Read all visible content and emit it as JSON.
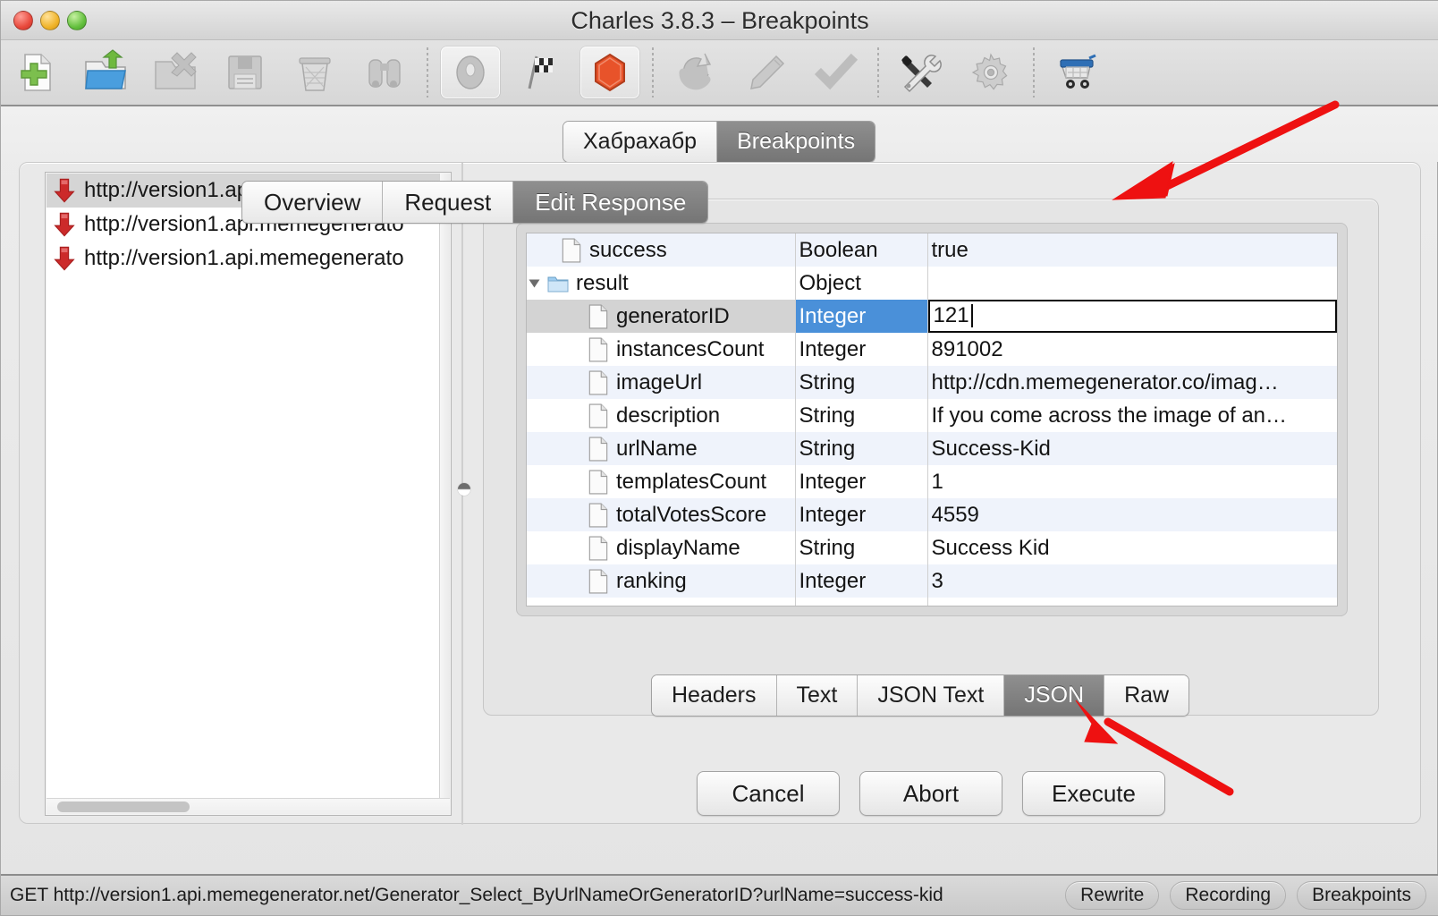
{
  "window": {
    "title": "Charles 3.8.3 – Breakpoints",
    "traffic_lights": [
      "close-button",
      "minimize-button",
      "zoom-button"
    ]
  },
  "toolbar": {
    "items": [
      {
        "name": "new-session-icon",
        "selected": false
      },
      {
        "name": "open-session-icon",
        "selected": false
      },
      {
        "name": "close-session-icon",
        "selected": false
      },
      {
        "name": "save-session-icon",
        "selected": false
      },
      {
        "name": "clear-session-icon",
        "selected": false
      },
      {
        "name": "find-icon",
        "selected": false
      },
      {
        "name": "record-icon",
        "selected": true
      },
      {
        "name": "throttle-icon",
        "selected": false
      },
      {
        "name": "stop-icon",
        "selected": true
      },
      {
        "name": "repeat-icon",
        "selected": false
      },
      {
        "name": "compose-icon",
        "selected": false
      },
      {
        "name": "validate-icon",
        "selected": false
      },
      {
        "name": "tools-icon",
        "selected": false
      },
      {
        "name": "settings-gear-icon",
        "selected": false
      },
      {
        "name": "shopping-cart-icon",
        "selected": false
      }
    ]
  },
  "window_tabs": [
    {
      "label": "Хабрахабр",
      "active": false
    },
    {
      "label": "Breakpoints",
      "active": true
    }
  ],
  "breakpoint_list": {
    "items": [
      {
        "label": "http://version1.api.memegenerato",
        "selected": true
      },
      {
        "label": "http://version1.api.memegenerato",
        "selected": false
      },
      {
        "label": "http://version1.api.memegenerato",
        "selected": false
      }
    ]
  },
  "detail_tabs": [
    {
      "label": "Overview",
      "active": false
    },
    {
      "label": "Request",
      "active": false
    },
    {
      "label": "Edit Response",
      "active": true
    }
  ],
  "json_table": {
    "rows": [
      {
        "indent": 0,
        "icon": "document-icon",
        "twisty": null,
        "name": "success",
        "type": "Boolean",
        "value": "true",
        "stripe": "odd",
        "selected": false,
        "editing": false
      },
      {
        "indent": 0,
        "icon": "folder-icon",
        "twisty": "open",
        "name": "result",
        "type": "Object",
        "value": "",
        "stripe": "even",
        "selected": false,
        "editing": false
      },
      {
        "indent": 1,
        "icon": "document-icon",
        "twisty": null,
        "name": "generatorID",
        "type": "Integer",
        "value": "121",
        "stripe": "odd",
        "selected": true,
        "editing": true
      },
      {
        "indent": 1,
        "icon": "document-icon",
        "twisty": null,
        "name": "instancesCount",
        "type": "Integer",
        "value": "891002",
        "stripe": "even",
        "selected": false,
        "editing": false
      },
      {
        "indent": 1,
        "icon": "document-icon",
        "twisty": null,
        "name": "imageUrl",
        "type": "String",
        "value": "http://cdn.memegenerator.co/imag…",
        "stripe": "odd",
        "selected": false,
        "editing": false
      },
      {
        "indent": 1,
        "icon": "document-icon",
        "twisty": null,
        "name": "description",
        "type": "String",
        "value": "If you come across the image of an…",
        "stripe": "even",
        "selected": false,
        "editing": false
      },
      {
        "indent": 1,
        "icon": "document-icon",
        "twisty": null,
        "name": "urlName",
        "type": "String",
        "value": "Success-Kid",
        "stripe": "odd",
        "selected": false,
        "editing": false
      },
      {
        "indent": 1,
        "icon": "document-icon",
        "twisty": null,
        "name": "templatesCount",
        "type": "Integer",
        "value": "1",
        "stripe": "even",
        "selected": false,
        "editing": false
      },
      {
        "indent": 1,
        "icon": "document-icon",
        "twisty": null,
        "name": "totalVotesScore",
        "type": "Integer",
        "value": "4559",
        "stripe": "odd",
        "selected": false,
        "editing": false
      },
      {
        "indent": 1,
        "icon": "document-icon",
        "twisty": null,
        "name": "displayName",
        "type": "String",
        "value": "Success Kid",
        "stripe": "even",
        "selected": false,
        "editing": false
      },
      {
        "indent": 1,
        "icon": "document-icon",
        "twisty": null,
        "name": "ranking",
        "type": "Integer",
        "value": "3",
        "stripe": "odd",
        "selected": false,
        "editing": false
      }
    ]
  },
  "format_tabs": [
    {
      "label": "Headers",
      "active": false
    },
    {
      "label": "Text",
      "active": false
    },
    {
      "label": "JSON Text",
      "active": false
    },
    {
      "label": "JSON",
      "active": true
    },
    {
      "label": "Raw",
      "active": false
    }
  ],
  "action_buttons": [
    {
      "label": "Cancel"
    },
    {
      "label": "Abort"
    },
    {
      "label": "Execute"
    }
  ],
  "statusbar": {
    "request": "GET http://version1.api.memegenerator.net/Generator_Select_ByUrlNameOrGeneratorID?urlName=success-kid",
    "toggles": [
      {
        "label": "Rewrite"
      },
      {
        "label": "Recording"
      },
      {
        "label": "Breakpoints"
      }
    ]
  },
  "annotations": [
    {
      "name": "arrow-to-edit-response-tab",
      "color": "#ee1111",
      "points_to": "Edit Response"
    },
    {
      "name": "arrow-to-json-format-tab",
      "color": "#ee1111",
      "points_to": "JSON"
    }
  ],
  "colors": {
    "selection_blue": "#4a90d9",
    "row_stripe": "#eff3fb",
    "annotation_red": "#ee1111",
    "active_tab_gray": "#808080"
  }
}
